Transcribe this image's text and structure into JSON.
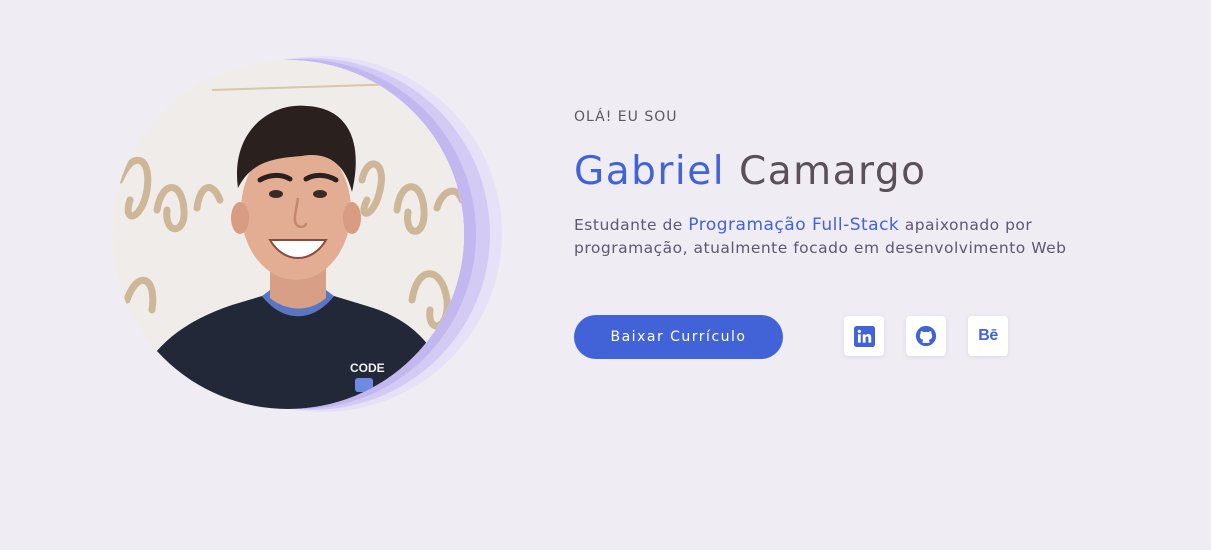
{
  "hero": {
    "greeting": "OLÁ! EU SOU",
    "first_name": "Gabriel",
    "last_name": "Camargo",
    "bio_prefix": "Estudante de ",
    "bio_highlight": "Programação Full-Stack",
    "bio_suffix": " apaixonado por programação, atualmente focado em desenvolvimento Web",
    "cv_button_label": "Baixar Currículo",
    "photo_alt": "Gabriel Camargo"
  },
  "social": [
    {
      "name": "LinkedIn",
      "icon": "linkedin-icon"
    },
    {
      "name": "GitHub",
      "icon": "github-icon"
    },
    {
      "name": "Behance",
      "icon": "behance-icon",
      "glyph": "Bē"
    }
  ],
  "colors": {
    "background": "#efecf3",
    "accent": "#4262d8",
    "name_secondary": "#5a5057",
    "halo": "#c3b7f0"
  }
}
